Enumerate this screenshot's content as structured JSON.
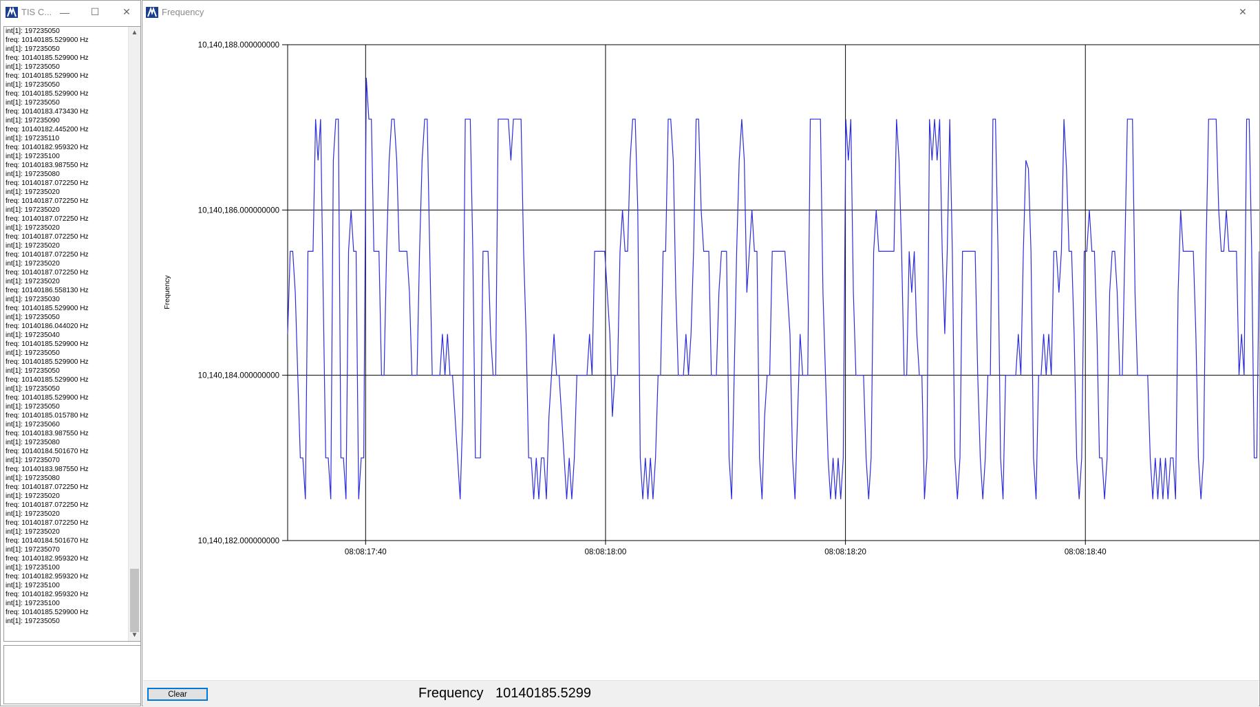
{
  "log_window": {
    "title": "TIS C...",
    "buttons": {
      "minimize": "—",
      "maximize": "☐",
      "close": "✕"
    },
    "lines": [
      "int[1]: 197235050",
      "freq: 10140185.529900 Hz",
      "int[1]: 197235050",
      "freq: 10140185.529900 Hz",
      "int[1]: 197235050",
      "freq: 10140185.529900 Hz",
      "int[1]: 197235050",
      "freq: 10140185.529900 Hz",
      "int[1]: 197235050",
      "freq: 10140183.473430 Hz",
      "int[1]: 197235090",
      "freq: 10140182.445200 Hz",
      "int[1]: 197235110",
      "freq: 10140182.959320 Hz",
      "int[1]: 197235100",
      "freq: 10140183.987550 Hz",
      "int[1]: 197235080",
      "freq: 10140187.072250 Hz",
      "int[1]: 197235020",
      "freq: 10140187.072250 Hz",
      "int[1]: 197235020",
      "freq: 10140187.072250 Hz",
      "int[1]: 197235020",
      "freq: 10140187.072250 Hz",
      "int[1]: 197235020",
      "freq: 10140187.072250 Hz",
      "int[1]: 197235020",
      "freq: 10140187.072250 Hz",
      "int[1]: 197235020",
      "freq: 10140186.558130 Hz",
      "int[1]: 197235030",
      "freq: 10140185.529900 Hz",
      "int[1]: 197235050",
      "freq: 10140186.044020 Hz",
      "int[1]: 197235040",
      "freq: 10140185.529900 Hz",
      "int[1]: 197235050",
      "freq: 10140185.529900 Hz",
      "int[1]: 197235050",
      "freq: 10140185.529900 Hz",
      "int[1]: 197235050",
      "freq: 10140185.529900 Hz",
      "int[1]: 197235050",
      "freq: 10140185.015780 Hz",
      "int[1]: 197235060",
      "freq: 10140183.987550 Hz",
      "int[1]: 197235080",
      "freq: 10140184.501670 Hz",
      "int[1]: 197235070",
      "freq: 10140183.987550 Hz",
      "int[1]: 197235080",
      "freq: 10140187.072250 Hz",
      "int[1]: 197235020",
      "freq: 10140187.072250 Hz",
      "int[1]: 197235020",
      "freq: 10140187.072250 Hz",
      "int[1]: 197235020",
      "freq: 10140184.501670 Hz",
      "int[1]: 197235070",
      "freq: 10140182.959320 Hz",
      "int[1]: 197235100",
      "freq: 10140182.959320 Hz",
      "int[1]: 197235100",
      "freq: 10140182.959320 Hz",
      "int[1]: 197235100",
      "freq: 10140185.529900 Hz",
      "int[1]: 197235050"
    ]
  },
  "freq_window": {
    "title": "Frequency",
    "close": "✕",
    "clear_label": "Clear",
    "readout_label": "Frequency",
    "readout_value": "10140185.5299"
  },
  "colors": {
    "series": "#2b2bdb",
    "grid": "#000000",
    "text": "#000000"
  },
  "chart_data": {
    "type": "line",
    "ylabel": "Frequency",
    "xlabel": "",
    "ylim": [
      10140182,
      10140188
    ],
    "y_ticks": [
      "10,140,182.000000000",
      "10,140,184.000000000",
      "10,140,186.000000000",
      "10,140,188.000000000"
    ],
    "x_ticks": [
      "08:08:17:40",
      "08:08:18:00",
      "08:08:18:20",
      "08:08:18:40"
    ],
    "x_start_seconds": 33.5,
    "x_end_seconds": 114.5,
    "grid": true,
    "series": [
      {
        "values": [
          10140184.5,
          10140185.5,
          10140185.5,
          10140185,
          10140184,
          10140183,
          10140183,
          10140182.5,
          10140185.5,
          10140185.5,
          10140185.5,
          10140187.1,
          10140186.6,
          10140187.1,
          10140185,
          10140183,
          10140183,
          10140182.5,
          10140186.6,
          10140187.1,
          10140187.1,
          10140183,
          10140183,
          10140182.5,
          10140185.5,
          10140186,
          10140185.5,
          10140185.5,
          10140182.5,
          10140183,
          10140183,
          10140187.6,
          10140187.1,
          10140187.1,
          10140185.5,
          10140185.5,
          10140185.5,
          10140184,
          10140184,
          10140185.5,
          10140186.6,
          10140187.1,
          10140187.1,
          10140186.6,
          10140185.5,
          10140185.5,
          10140185.5,
          10140185.5,
          10140185,
          10140184,
          10140184,
          10140184,
          10140185.5,
          10140186.6,
          10140187.1,
          10140187.1,
          10140185.5,
          10140184,
          10140184,
          10140184,
          10140184,
          10140184.5,
          10140184,
          10140184.5,
          10140184,
          10140184,
          10140183.5,
          10140183,
          10140182.5,
          10140183.5,
          10140187.1,
          10140187.1,
          10140187.1,
          10140185.5,
          10140183,
          10140183,
          10140183,
          10140185.5,
          10140185.5,
          10140185.5,
          10140184.5,
          10140184,
          10140184,
          10140187.1,
          10140187.1,
          10140187.1,
          10140187.1,
          10140187.1,
          10140186.6,
          10140187.1,
          10140187.1,
          10140187.1,
          10140187.1,
          10140185.5,
          10140184.5,
          10140183,
          10140183,
          10140182.5,
          10140183,
          10140182.5,
          10140183,
          10140183,
          10140182.5,
          10140183.5,
          10140184,
          10140184.5,
          10140184,
          10140184,
          10140183.5,
          10140183,
          10140182.5,
          10140183,
          10140182.5,
          10140183,
          10140184,
          10140184,
          10140184,
          10140184,
          10140184,
          10140184.5,
          10140184,
          10140185.5,
          10140185.5,
          10140185.5,
          10140185.5,
          10140185.5,
          10140185,
          10140184.5,
          10140183.5,
          10140184,
          10140184,
          10140185.5,
          10140186,
          10140185.5,
          10140185.5,
          10140186.6,
          10140187.1,
          10140187.1,
          10140186,
          10140183,
          10140182.5,
          10140183,
          10140182.5,
          10140183,
          10140182.5,
          10140183,
          10140184,
          10140184,
          10140185.5,
          10140185.5,
          10140187.1,
          10140187.1,
          10140186.6,
          10140185,
          10140184,
          10140184,
          10140184,
          10140184.5,
          10140184,
          10140184.5,
          10140185.5,
          10140187.1,
          10140187.1,
          10140186,
          10140185.5,
          10140185.5,
          10140185.5,
          10140184,
          10140184,
          10140184,
          10140185,
          10140185.5,
          10140185.5,
          10140185.5,
          10140183,
          10140182.5,
          10140184,
          10140185.5,
          10140186.6,
          10140187.1,
          10140186.6,
          10140185,
          10140185.5,
          10140186,
          10140185.5,
          10140185.5,
          10140183,
          10140182.5,
          10140183.5,
          10140184,
          10140184,
          10140185.5,
          10140185.5,
          10140185.5,
          10140185.5,
          10140185.5,
          10140185.5,
          10140185,
          10140184.5,
          10140183,
          10140182.5,
          10140183.5,
          10140184.5,
          10140184,
          10140184,
          10140184,
          10140187.1,
          10140187.1,
          10140187.1,
          10140187.1,
          10140187.1,
          10140185,
          10140184,
          10140183,
          10140182.5,
          10140183,
          10140182.5,
          10140183,
          10140182.5,
          10140183,
          10140187.1,
          10140186.6,
          10140187.1,
          10140185,
          10140184,
          10140184,
          10140184,
          10140184,
          10140183,
          10140182.5,
          10140183,
          10140185.5,
          10140186,
          10140185.5,
          10140185.5,
          10140185.5,
          10140185.5,
          10140185.5,
          10140185.5,
          10140185.5,
          10140187.1,
          10140186.6,
          10140185.5,
          10140184,
          10140184,
          10140185.5,
          10140185,
          10140185.5,
          10140184.5,
          10140184,
          10140184,
          10140182.5,
          10140183,
          10140187.1,
          10140186.6,
          10140187.1,
          10140186.6,
          10140187.1,
          10140185.5,
          10140184.5,
          10140185.5,
          10140187.1,
          10140185.5,
          10140183,
          10140182.5,
          10140183,
          10140185.5,
          10140185.5,
          10140185.5,
          10140185.5,
          10140185.5,
          10140185.5,
          10140184,
          10140183,
          10140182.5,
          10140183,
          10140184,
          10140184,
          10140187.1,
          10140187.1,
          10140185.5,
          10140183,
          10140182.5,
          10140184,
          10140184,
          10140184,
          10140184,
          10140184,
          10140184.5,
          10140184,
          10140185.5,
          10140186.6,
          10140186.5,
          10140185.5,
          10140183,
          10140182.5,
          10140184,
          10140184,
          10140184.5,
          10140184,
          10140184.5,
          10140184,
          10140185.5,
          10140185.5,
          10140185,
          10140185.5,
          10140187.1,
          10140186.5,
          10140185.5,
          10140185.5,
          10140184.5,
          10140183,
          10140182.5,
          10140183,
          10140185.5,
          10140185.5,
          10140186,
          10140185.5,
          10140185.5,
          10140184.5,
          10140183,
          10140183,
          10140182.5,
          10140183,
          10140185,
          10140185.5,
          10140185.5,
          10140185,
          10140184,
          10140184,
          10140185.5,
          10140187.1,
          10140187.1,
          10140187.1,
          10140185,
          10140184,
          10140184,
          10140184,
          10140184,
          10140184,
          10140183,
          10140182.5,
          10140183,
          10140182.5,
          10140183,
          10140182.5,
          10140183,
          10140182.5,
          10140183,
          10140183,
          10140182.5,
          10140185,
          10140186,
          10140185.5,
          10140185.5,
          10140185.5,
          10140185.5,
          10140185.5,
          10140184.5,
          10140183,
          10140182.5,
          10140183,
          10140185.5,
          10140187.1,
          10140187.1,
          10140187.1,
          10140187.1,
          10140186,
          10140185.5,
          10140185.5,
          10140186,
          10140185.5,
          10140185.5,
          10140185.5,
          10140185.5,
          10140184,
          10140184.5,
          10140184,
          10140187.1,
          10140187.1,
          10140185.5,
          10140183,
          10140183,
          10140185.5
        ]
      }
    ]
  }
}
